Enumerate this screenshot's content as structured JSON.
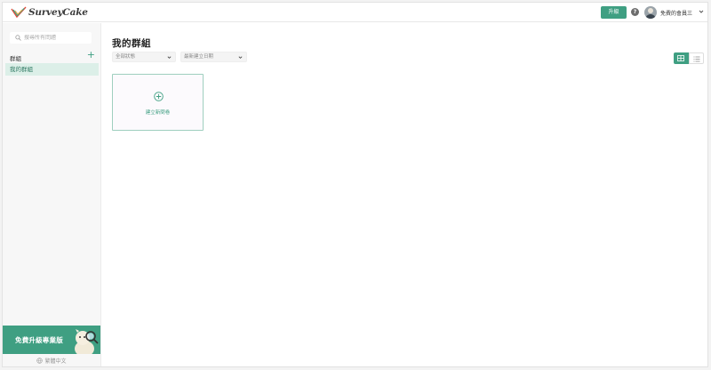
{
  "header": {
    "logo_text": "SurveyCake",
    "upgrade_label": "升級",
    "help_icon": "question-circle-icon",
    "user_name": "免費的會員三"
  },
  "sidebar": {
    "search_placeholder": "搜尋所有問題",
    "groups_label": "群組",
    "add_group": "+",
    "items": [
      {
        "label": "我的群組",
        "active": true
      }
    ],
    "promo_text": "免費升級專業版",
    "language": "繁體中文"
  },
  "main": {
    "title": "我的群組",
    "filter_status": "全部狀態",
    "sort_order": "最新建立日期",
    "view_mode": "grid",
    "new_survey_label": "建立新問卷"
  },
  "colors": {
    "brand": "#3f9f82",
    "active_item_bg": "#dcefe8",
    "card_border": "#9fcfbf"
  }
}
